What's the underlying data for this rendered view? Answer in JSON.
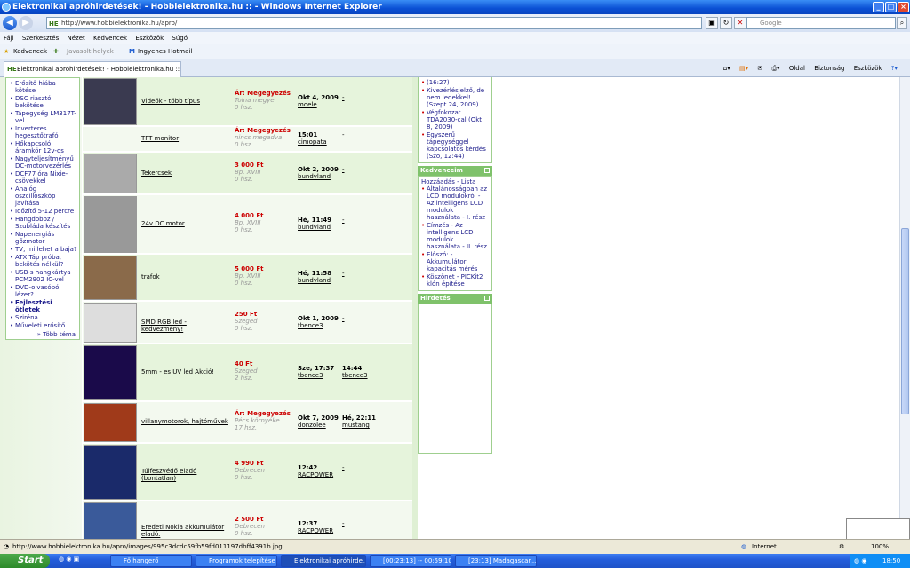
{
  "window": {
    "title": "Elektronikai apróhirdetések! - Hobbielektronika.hu :: - Windows Internet Explorer"
  },
  "address": {
    "url_host": "http://www.hobbielektronika.hu",
    "url_path": "/apro/",
    "favicon": "HE",
    "search_placeholder": "Google"
  },
  "menu": [
    "Fájl",
    "Szerkesztés",
    "Nézet",
    "Kedvencek",
    "Eszközök",
    "Súgó"
  ],
  "favbar": {
    "favorites": "Kedvencek",
    "suggested": "Javasolt helyek",
    "hotmail": "Ingyenes Hotmail"
  },
  "tab": {
    "label": "Elektronikai apróhirdetések! - Hobbielektronika.hu ::"
  },
  "cmdbar": {
    "page": "Oldal",
    "safety": "Biztonság",
    "tools": "Eszközök"
  },
  "left_nav": {
    "items": [
      {
        "text": "Erősítő hiába kötése",
        "bold": false
      },
      {
        "text": "DSC riasztó bekötése",
        "bold": false
      },
      {
        "text": "Tápegység LM317T-vel",
        "bold": false
      },
      {
        "text": "Inverteres hegesztőtrafó",
        "bold": false
      },
      {
        "text": "Hőkapcsoló áramkör 12v-os",
        "bold": false
      },
      {
        "text": "Nagyteljesítményű DC-motorvezérlés",
        "bold": false
      },
      {
        "text": "DCF77 óra Nixie-csövekkel",
        "bold": false
      },
      {
        "text": "Analóg oszcilloszkóp javítása",
        "bold": false
      },
      {
        "text": "Időzítő 5-12 percre",
        "bold": false
      },
      {
        "text": "Hangdoboz / Szubláda készítés",
        "bold": false
      },
      {
        "text": "Napenergiás gőzmotor",
        "bold": false
      },
      {
        "text": "TV, mi lehet a baja?",
        "bold": false
      },
      {
        "text": "ATX Táp próba, bekötés nélkül?",
        "bold": false
      },
      {
        "text": "USB-s hangkártya PCM2902 IC-vel",
        "bold": false
      },
      {
        "text": "DVD-olvasóból lézer?",
        "bold": false
      },
      {
        "text": "Fejlesztési ötletek",
        "bold": true
      },
      {
        "text": "Sziréna",
        "bold": false
      },
      {
        "text": "Műveleti erősítő",
        "bold": false
      }
    ],
    "more": "» Több téma"
  },
  "listings": [
    {
      "title": "Videók - több típus",
      "price": "Ár: Megegyezés",
      "place": "Tolna megye",
      "views": "0 hsz.",
      "date": "Okt 4, 2009",
      "user": "moele",
      "last_date": "",
      "last_user": "-"
    },
    {
      "title": "TFT monitor",
      "price": "Ár: Megegyezés",
      "place": "nincs megadva",
      "views": "0 hsz.",
      "date": "15:01",
      "user": "cimopata",
      "last_date": "",
      "last_user": "-"
    },
    {
      "title": "Tekercsek",
      "price": "3 000 Ft",
      "place": "Bp. XVIII",
      "views": "0 hsz.",
      "date": "Okt 2, 2009",
      "user": "bundyland",
      "last_date": "",
      "last_user": "-"
    },
    {
      "title": "24v DC motor",
      "price": "4 000 Ft",
      "place": "Bp. XVIII",
      "views": "0 hsz.",
      "date": "Hé, 11:49",
      "user": "bundyland",
      "last_date": "",
      "last_user": "-"
    },
    {
      "title": "trafok",
      "price": "5 000 Ft",
      "place": "Bp. XVIII",
      "views": "0 hsz.",
      "date": "Hé, 11:58",
      "user": "bundyland",
      "last_date": "",
      "last_user": "-"
    },
    {
      "title": "SMD RGB led - kedvezmény!",
      "price": "250 Ft",
      "place": "Szeged",
      "views": "0 hsz.",
      "date": "Okt 1, 2009",
      "user": "tbence3",
      "last_date": "",
      "last_user": "-"
    },
    {
      "title": "5mm - es UV led Akció!",
      "price": "40 Ft",
      "place": "Szeged",
      "views": "2 hsz.",
      "date": "Sze, 17:37",
      "user": "tbence3",
      "last_date": "14:44",
      "last_user": "tbence3"
    },
    {
      "title": "villanymotorok, hajtóművek",
      "price": "Ár: Megegyezés",
      "place": "Pécs környéke",
      "views": "17 hsz.",
      "date": "Okt 7, 2009",
      "user": "donzolee",
      "last_date": "Hé, 22:11",
      "last_user": "mustang"
    },
    {
      "title": "Túlfeszvédő eladó (bontatlan)",
      "price": "4 990 Ft",
      "place": "Debrecen",
      "views": "0 hsz.",
      "date": "12:42",
      "user": "RACPOWER",
      "last_date": "",
      "last_user": "-"
    },
    {
      "title": "Eredeti Nokia akkumulátor eladó.",
      "price": "2 500 Ft",
      "place": "Debrecen",
      "views": "0 hsz.",
      "date": "12:37",
      "user": "RACPOWER",
      "last_date": "",
      "last_user": "-"
    }
  ],
  "right_top": {
    "items": [
      "(16:27)",
      "Kivezérlésjelző, de nem ledekkel! (Szept 24, 2009)",
      "Végfokozat TDA2030-cal (Okt 8, 2009)",
      "Egyszerű tápegységgel kapcsolatos kérdés (Szo, 12:44)"
    ]
  },
  "kedvenceim": {
    "title": "Kedvenceim",
    "sub": "Hozzáadás - Lista",
    "items": [
      "Általánosságban az LCD modulokról - Az intelligens LCD modulok használata - I. rész",
      "Címzés - Az intelligens LCD modulok használata - II. rész",
      "Előszó: - Akkumulátor kapacitás mérés",
      "Köszönet - PICKit2 klón építése"
    ]
  },
  "hirdetes": {
    "title": "Hirdetés"
  },
  "status": {
    "url": "http://www.hobbielektronika.hu/apro/images/995c3dcdc59fb59fd011197dbff4391b.jpg",
    "zone": "Internet",
    "zoom": "100%"
  },
  "taskbar": {
    "start": "Start",
    "tasks": [
      "Fő hangerő",
      "Programok telepítése ...",
      "Elektronikai apróhirde...",
      "[00:23:13] -- 00:59:10]",
      "[23:13] Madagascar...."
    ],
    "clock": "18:50"
  },
  "colors": {
    "accent_green": "#7fc26b",
    "price_red": "#cc0000",
    "link_blue": "#1a1a8a",
    "title_blue": "#0a4fd4"
  }
}
